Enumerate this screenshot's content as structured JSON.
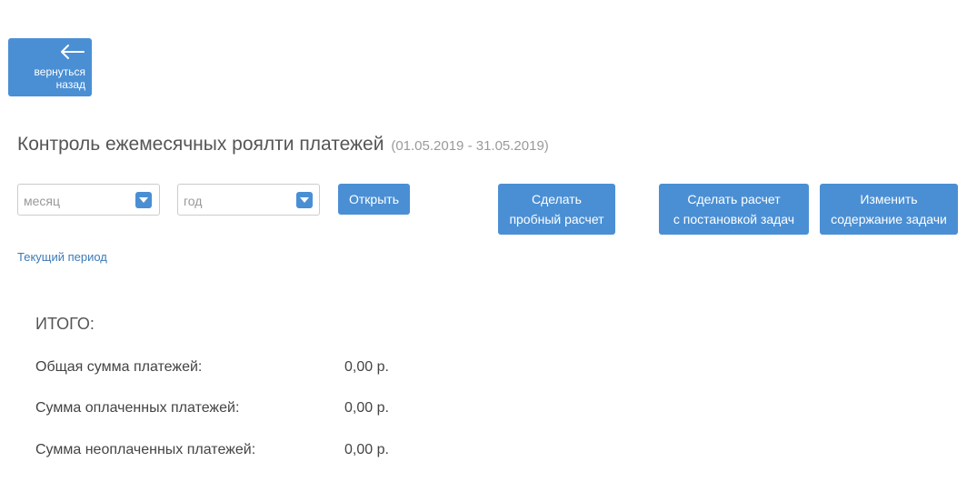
{
  "back_button": {
    "label": "вернуться\nназад",
    "icon": "arrow-left-icon"
  },
  "header": {
    "title": "Контроль ежемесячных роялти платежей",
    "period": "(01.05.2019 - 31.05.2019)"
  },
  "filters": {
    "month_placeholder": "месяц",
    "year_placeholder": "год",
    "open_label": "Открыть"
  },
  "actions": {
    "trial_calc": "Сделать\nпробный расчет",
    "calc_with_tasks": "Сделать расчет\nс постановкой задач",
    "change_task": "Изменить\nсодержание задачи"
  },
  "current_period_link": "Текущий период",
  "totals": {
    "heading": "ИТОГО:",
    "rows": [
      {
        "label": "Общая сумма платежей:",
        "value": "0,00 р."
      },
      {
        "label": "Сумма оплаченных платежей:",
        "value": "0,00 р."
      },
      {
        "label": "Сумма неоплаченных платежей:",
        "value": "0,00 р."
      }
    ]
  },
  "colors": {
    "accent": "#4a8fd4",
    "link": "#3d7ab8"
  }
}
